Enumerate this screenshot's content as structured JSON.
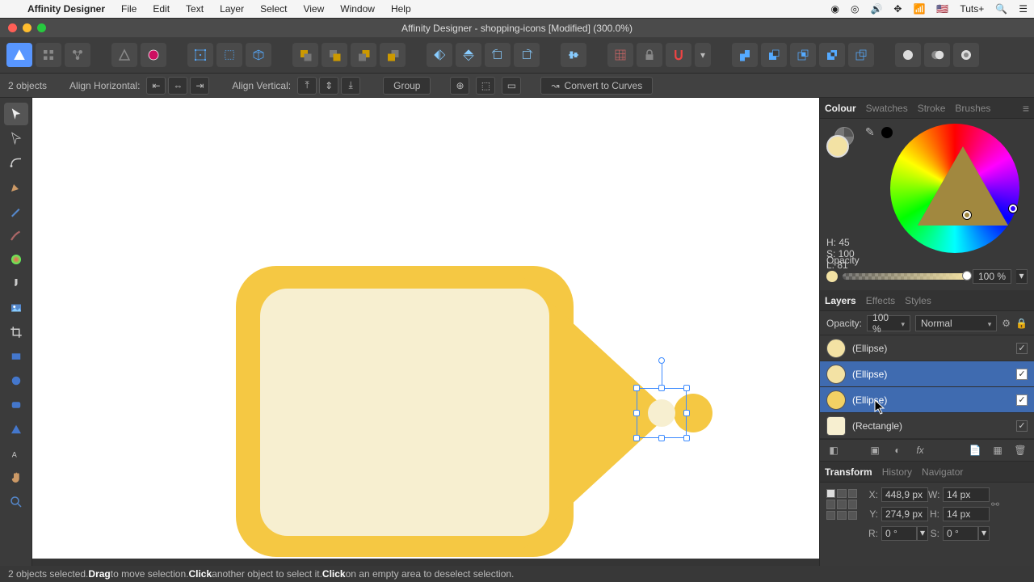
{
  "menubar": {
    "app_name": "Affinity Designer",
    "items": [
      "File",
      "Edit",
      "Text",
      "Layer",
      "Select",
      "View",
      "Window",
      "Help"
    ],
    "right_text": "Tuts+"
  },
  "window": {
    "title": "Affinity Designer - shopping-icons [Modified] (300.0%)"
  },
  "context_toolbar": {
    "selection_label": "2 objects",
    "align_h_label": "Align Horizontal:",
    "align_v_label": "Align Vertical:",
    "group_label": "Group",
    "convert_label": "Convert to Curves"
  },
  "panels": {
    "colour_tabs": [
      "Colour",
      "Swatches",
      "Stroke",
      "Brushes"
    ],
    "colour_active": "Colour",
    "hsl": {
      "h": "H: 45",
      "s": "S: 100",
      "l": "L: 81"
    },
    "opacity_label": "Opacity",
    "opacity_value": "100 %",
    "layers_tabs": [
      "Layers",
      "Effects",
      "Styles"
    ],
    "layers_active": "Layers",
    "layer_opacity_label": "Opacity:",
    "layer_opacity_value": "100 %",
    "blend_mode": "Normal",
    "layers": [
      {
        "name": "(Ellipse)",
        "selected": false,
        "thumb": "cream-ellipse"
      },
      {
        "name": "(Ellipse)",
        "selected": true,
        "thumb": "cream-ellipse"
      },
      {
        "name": "(Ellipse)",
        "selected": true,
        "thumb": "yellow-ellipse"
      },
      {
        "name": "(Rectangle)",
        "selected": false,
        "thumb": "cream-rect"
      }
    ],
    "transform_tabs": [
      "Transform",
      "History",
      "Navigator"
    ],
    "transform_active": "Transform",
    "transform": {
      "x_label": "X:",
      "x": "448,9 px",
      "y_label": "Y:",
      "y": "274,9 px",
      "w_label": "W:",
      "w": "14 px",
      "h_label": "H:",
      "h": "14 px",
      "r_label": "R:",
      "r": "0 °",
      "s_label": "S:",
      "s": "0 °"
    }
  },
  "status": {
    "prefix": "2 objects selected. ",
    "b1": "Drag",
    "t1": " to move selection. ",
    "b2": "Click",
    "t2": " another object to select it. ",
    "b3": "Click",
    "t3": " on an empty area to deselect selection."
  },
  "colors": {
    "tag": "#f5c843",
    "tag_inner": "#f7efd0",
    "selected_row": "#3f6bb0"
  }
}
